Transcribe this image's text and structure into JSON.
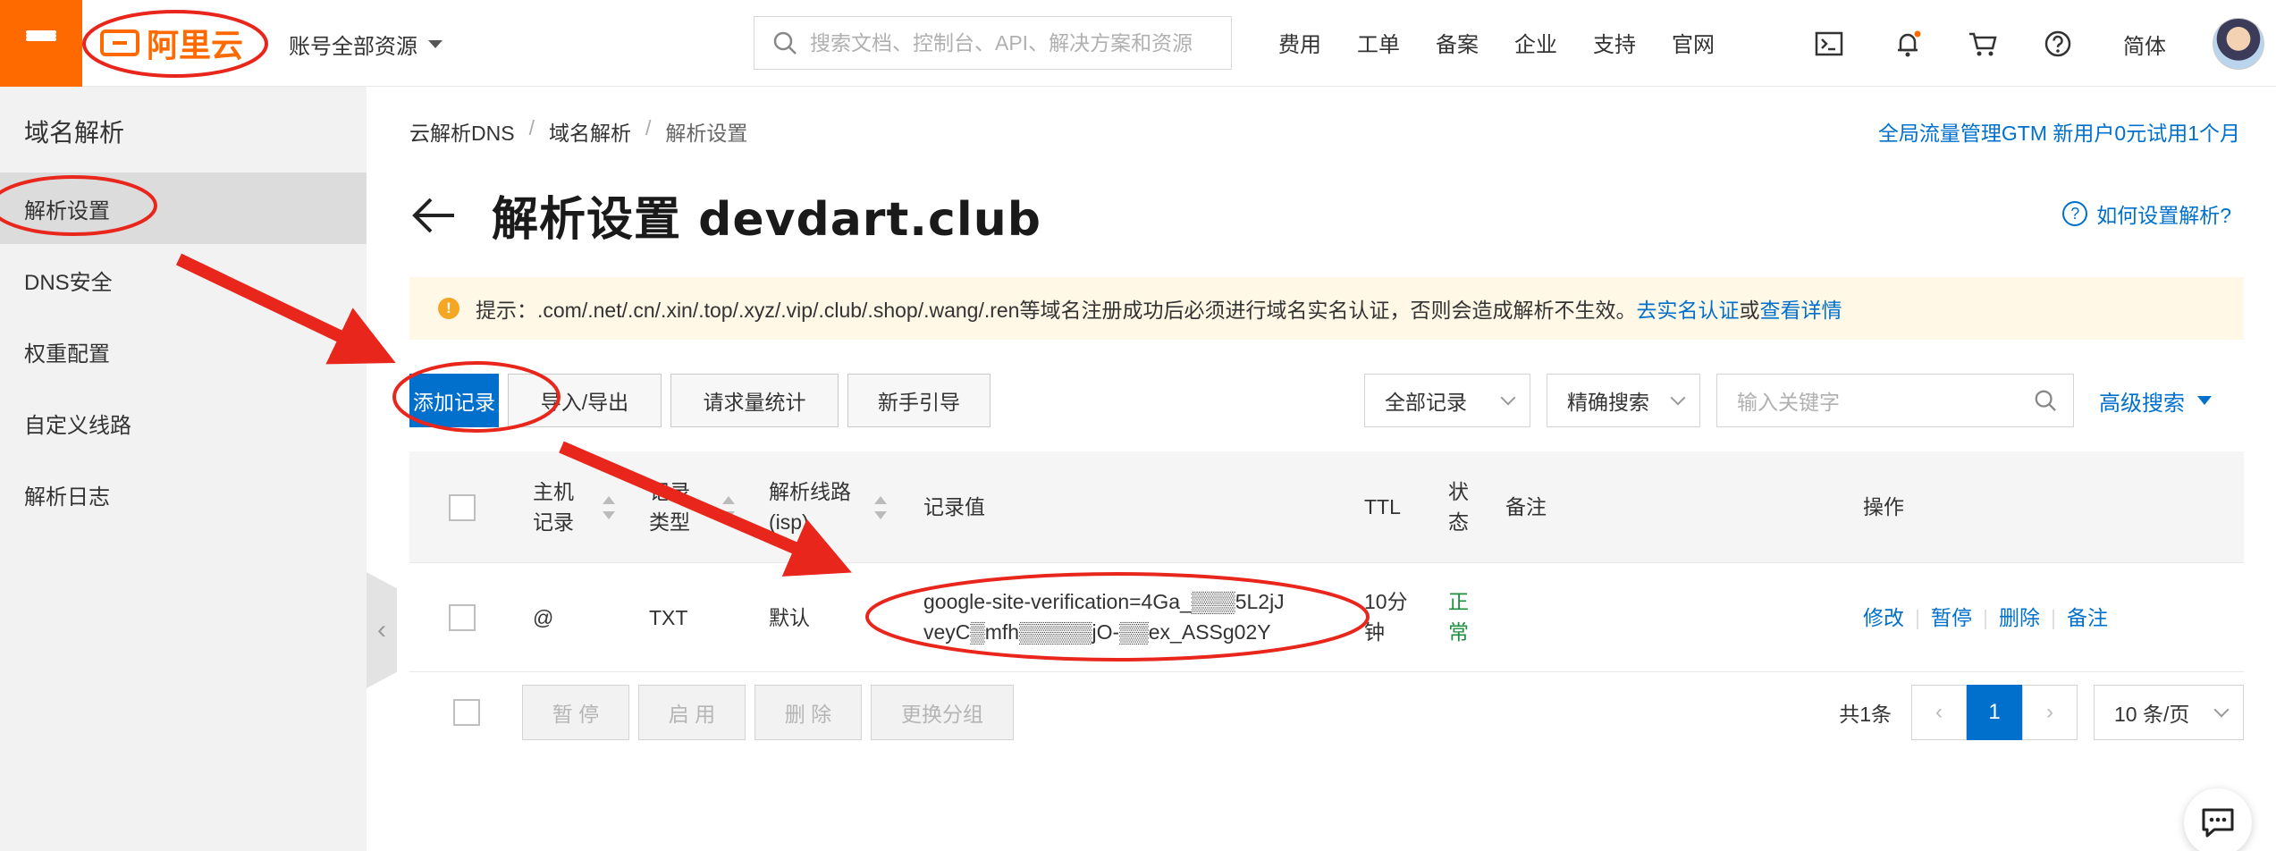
{
  "header": {
    "logo_text": "阿里云",
    "account_label": "账号全部资源",
    "search_placeholder": "搜索文档、控制台、API、解决方案和资源",
    "nav": [
      "费用",
      "工单",
      "备案",
      "企业",
      "支持",
      "官网"
    ],
    "lang": "简体"
  },
  "sidebar": {
    "title": "域名解析",
    "items": [
      {
        "label": "解析设置",
        "active": true
      },
      {
        "label": "DNS安全"
      },
      {
        "label": "权重配置"
      },
      {
        "label": "自定义线路"
      },
      {
        "label": "解析日志"
      }
    ]
  },
  "breadcrumb": [
    "云解析DNS",
    "域名解析",
    "解析设置"
  ],
  "promo": "全局流量管理GTM 新用户0元试用1个月",
  "page_title": "解析设置 devdart.club",
  "help_link": "如何设置解析?",
  "notice": {
    "icon_text": "!",
    "text": "提示：.com/.net/.cn/.xin/.top/.xyz/.vip/.club/.shop/.wang/.ren等域名注册成功后必须进行域名实名认证，否则会造成解析不生效。",
    "link1": "去实名认证",
    "or": "或",
    "link2": "查看详情"
  },
  "toolbar": {
    "add": "添加记录",
    "import_export": "导入/导出",
    "stats": "请求量统计",
    "guide": "新手引导"
  },
  "filters": {
    "record_filter": "全部记录",
    "search_mode": "精确搜索",
    "keyword_placeholder": "输入关键字",
    "advanced": "高级搜索"
  },
  "table": {
    "headers": {
      "host": "主机记录",
      "type": "记录类型",
      "line": "解析线路(isp)",
      "value": "记录值",
      "ttl": "TTL",
      "status": "状态",
      "remark": "备注",
      "ops": "操作"
    },
    "rows": [
      {
        "host": "@",
        "type": "TXT",
        "line": "默认",
        "value_line1": "google-site-verification=4Ga_▒▒▒5L2jJ",
        "value_line2": "veyC▒mfh▒▒▒▒▒jO-▒▒ex_ASSg02Y",
        "ttl": "10分钟",
        "status": "正常",
        "remark": "",
        "ops": [
          "修改",
          "暂停",
          "删除",
          "备注"
        ]
      }
    ]
  },
  "bulk_actions": [
    "暂 停",
    "启 用",
    "删 除",
    "更换分组"
  ],
  "pagination": {
    "total": "共1条",
    "current": "1",
    "page_size": "10 条/页"
  },
  "colors": {
    "brand_orange": "#ff6a00",
    "primary_blue": "#0070cc",
    "annotation_red": "#e8261c",
    "status_green": "#1e8e3e"
  }
}
